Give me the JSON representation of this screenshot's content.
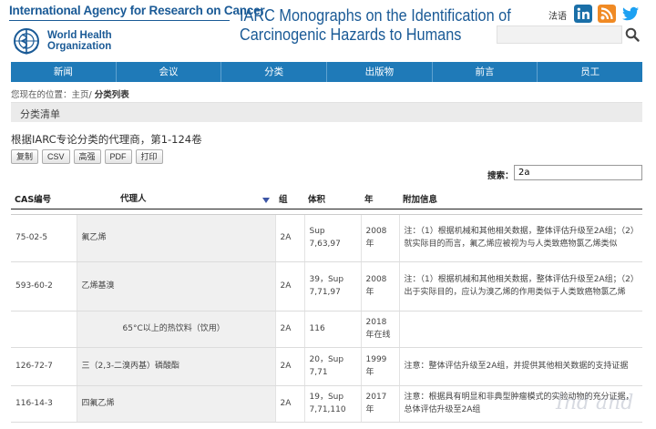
{
  "header": {
    "iarc_name": "International Agency for Research on Cancer",
    "who_line1": "World Health",
    "who_line2": "Organization",
    "title_line1": "IARC Monographs on the Identification of",
    "title_line2": "Carcinogenic Hazards to Humans",
    "lang_label": "法语",
    "search_placeholder": "",
    "brand_color": "#1a5a96"
  },
  "nav": {
    "items": [
      "新闻",
      "会议",
      "分类",
      "出版物",
      "前言",
      "员工"
    ],
    "bg_color": "#1f7ab8"
  },
  "breadcrumb": {
    "prefix": "您现在的位置：",
    "home": "主页/",
    "current": "分类列表"
  },
  "section": {
    "title": "分类清单"
  },
  "subtitle": "根据IARC专论分类的代理商，第1-124卷",
  "buttons": [
    "复制",
    "CSV",
    "高强",
    "PDF",
    "打印"
  ],
  "filter": {
    "label": "搜索：",
    "value": "2a"
  },
  "table": {
    "headers": [
      "CAS编号",
      "代理人",
      "组",
      "体积",
      "年",
      "附加信息"
    ],
    "rows": [
      {
        "cas": "75-02-5",
        "agent": "氟乙烯",
        "group": "2A",
        "volume": [
          "Sup",
          "7,63,97"
        ],
        "year": [
          "2008",
          "年"
        ],
        "info": "注：（1）根据机械和其他相关数据，整体评估升级至2A组；（2）就实际目的而言，氟乙烯应被视为与人类致癌物氯乙烯类似"
      },
      {
        "cas": "593-60-2",
        "agent": "乙烯基溴",
        "group": "2A",
        "volume": [
          "39，Sup",
          "7,71,97"
        ],
        "year": [
          "2008",
          "年"
        ],
        "info": "注：（1）根据机械和其他相关数据，整体评估升级至2A组；（2）出于实际目的，应认为溴乙烯的作用类似于人类致癌物氯乙烯"
      },
      {
        "cas": "",
        "agent": "65°C以上的热饮料（饮用）",
        "group": "2A",
        "volume": [
          "116"
        ],
        "year": [
          "2018",
          "年在线"
        ],
        "info": ""
      },
      {
        "cas": "126-72-7",
        "agent": "三（2,3-二溴丙基）磷酸酯",
        "group": "2A",
        "volume": [
          "20，Sup",
          "7,71"
        ],
        "year": [
          "1999",
          "年"
        ],
        "info": "注意：整体评估升级至2A组，并提供其他相关数据的支持证据"
      },
      {
        "cas": "116-14-3",
        "agent": "四氟乙烯",
        "group": "2A",
        "volume": [
          "19，Sup",
          "7,71,110"
        ],
        "year": [
          "2017",
          "年"
        ],
        "info": "注意：根据具有明显和非典型肿瘤模式的实验动物的充分证据，总体评估升级至2A组"
      }
    ]
  },
  "watermark": "Ind and"
}
